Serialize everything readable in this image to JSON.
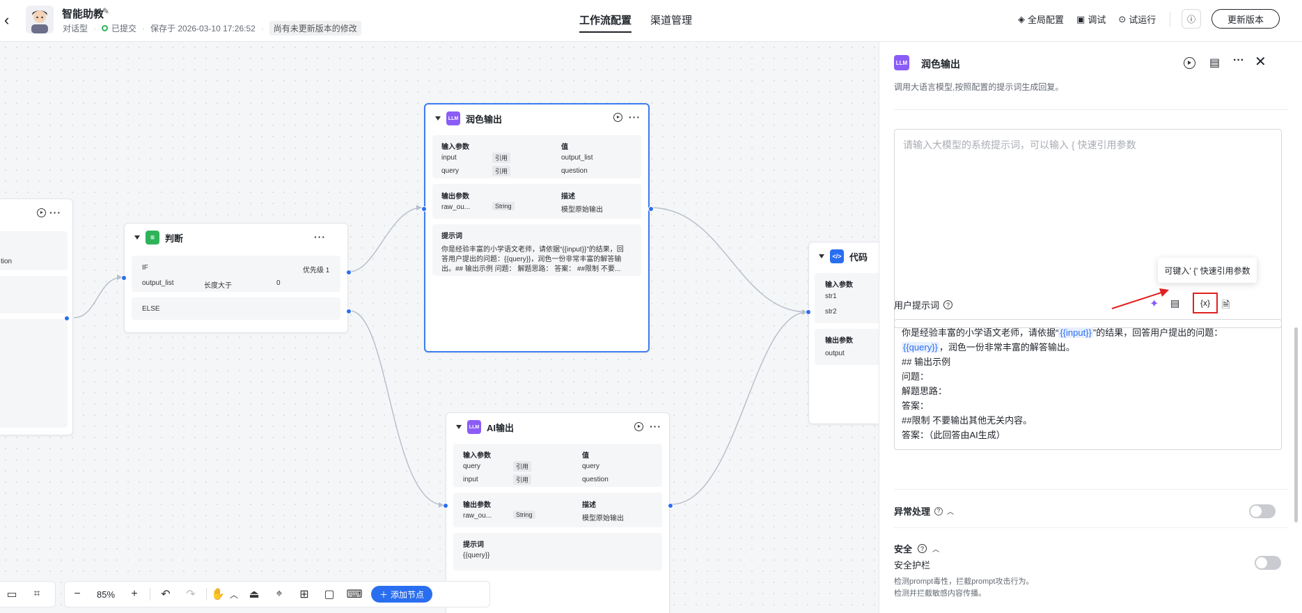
{
  "header": {
    "app_name": "智能助教",
    "app_type": "对话型",
    "status": "已提交",
    "saved_at": "保存于 2026-03-10 17:26:52",
    "unsaved_hint": "尚有未更新版本的修改",
    "tabs": [
      "工作流配置",
      "渠道管理"
    ],
    "actions": {
      "global_config": "全局配置",
      "debug": "调试",
      "trial_run": "试运行",
      "update_version": "更新版本"
    }
  },
  "nodes": {
    "left_partial": {
      "text": "tion"
    },
    "judge": {
      "title": "判断",
      "if_label": "IF",
      "priority": "优先级 1",
      "condition_var": "output_list",
      "condition_op": "长度大于",
      "condition_val": "0",
      "else_label": "ELSE"
    },
    "polish": {
      "icon": "LLM",
      "title": "润色输出",
      "in_header": "输入参数",
      "val_header": "值",
      "inputs": [
        {
          "name": "input",
          "type": "引用",
          "value": "output_list"
        },
        {
          "name": "query",
          "type": "引用",
          "value": "question"
        }
      ],
      "out_header": "输出参数",
      "desc_header": "描述",
      "outputs": [
        {
          "name": "raw_ou...",
          "type": "String",
          "desc": "模型原始输出"
        }
      ],
      "prompt_header": "提示词",
      "prompt_preview": [
        "你是经验丰富的小学语文老师，请依据“{{input}}”的结果，回",
        "答用户提出的问题：{{query}}，润色一份非常丰富的解答输",
        "出。## 输出示例 问题： 解题思路： 答案： ##限制 不要..."
      ]
    },
    "ai": {
      "icon": "LLM",
      "title": "AI输出",
      "in_header": "输入参数",
      "val_header": "值",
      "inputs": [
        {
          "name": "query",
          "type": "引用",
          "value": "query"
        },
        {
          "name": "input",
          "type": "引用",
          "value": "question"
        }
      ],
      "out_header": "输出参数",
      "desc_header": "描述",
      "outputs": [
        {
          "name": "raw_ou...",
          "type": "String",
          "desc": "模型原始输出"
        }
      ],
      "prompt_header": "提示词",
      "prompt_preview": "{{query}}"
    },
    "code": {
      "title": "代码",
      "in_header": "输入参数",
      "inputs": [
        "str1",
        "str2"
      ],
      "out_header": "输出参数",
      "outputs": [
        "output"
      ]
    }
  },
  "toolbar": {
    "zoom": "85%",
    "add_node": "添加节点"
  },
  "panel": {
    "icon": "LLM",
    "title": "润色输出",
    "description": "调用大语言模型,按照配置的提示词生成回复。",
    "system_prompt_placeholder": "请输入大模型的系统提示词，可以输入 { 快速引用参数",
    "tooltip": "可键入' {' 快速引用参数",
    "user_prompt_label": "用户提示词",
    "user_prompt": {
      "line1_a": "你是经验丰富的小学语文老师，请依据“",
      "var_input": "{{input}}",
      "line1_b": "”的结果，回答用户提出的问题：",
      "var_query": "{{query}}",
      "line2_b": "，润色一份非常丰富的解答输出。",
      "lines": [
        "## 输出示例",
        "问题：",
        "解题思路：",
        "答案：",
        "##限制  不要输出其他无关内容。",
        "答案：（此回答由AI生成）"
      ]
    },
    "exception_label": "异常处理",
    "security_label": "安全",
    "guard_label": "安全护栏",
    "guard_desc": [
      "检测prompt毒性，拦截prompt攻击行为。",
      "检测并拦截敏感内容传播。"
    ]
  }
}
